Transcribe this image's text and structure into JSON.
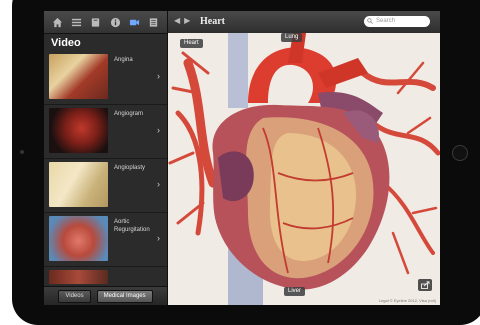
{
  "sidebar": {
    "title": "Video",
    "toolbar_icons": [
      "home-icon",
      "list-icon",
      "book-icon",
      "info-icon",
      "video-icon",
      "notes-icon"
    ],
    "items": [
      {
        "label": "Angina"
      },
      {
        "label": "Angiogram"
      },
      {
        "label": "Angioplasty"
      },
      {
        "label": "Aortic Regurgitation"
      }
    ],
    "segments": {
      "videos": "Videos",
      "medical_images": "Medical Images"
    }
  },
  "main": {
    "title": "Heart",
    "search_placeholder": "Search",
    "nav_back": "◀",
    "nav_forward": "▶",
    "tag_heart": "Heart",
    "tag_lung": "Lung",
    "tag_liver": "Liver",
    "credit": "Legal © Eyeline 2012, Visa (roll)"
  },
  "colors": {
    "accent": "#c73a3a",
    "toolbar": "#3a3a3a"
  }
}
